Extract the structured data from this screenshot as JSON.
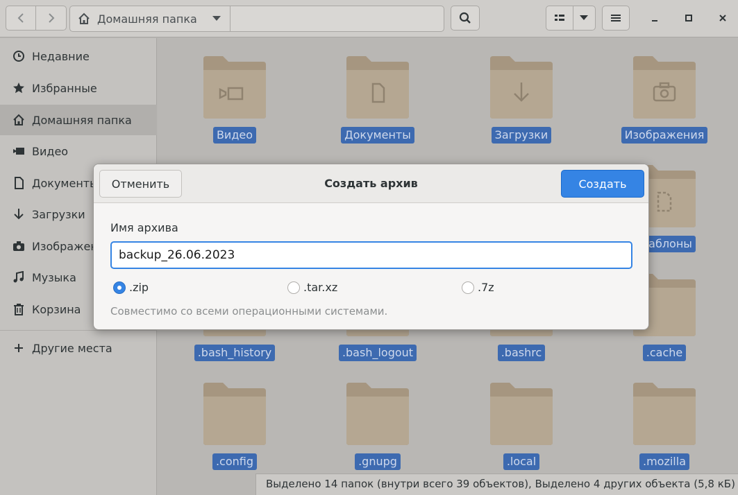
{
  "header": {
    "back_icon": "chevron-left-icon",
    "forward_icon": "chevron-right-icon",
    "path_home_label": "Домашняя папка",
    "search_icon": "search-icon",
    "view_icon": "list-view-icon",
    "menu_icon": "hamburger-menu-icon"
  },
  "sidebar": {
    "items": [
      {
        "label": "Недавние",
        "icon": "clock-icon"
      },
      {
        "label": "Избранные",
        "icon": "star-icon"
      },
      {
        "label": "Домашняя папка",
        "icon": "home-icon"
      },
      {
        "label": "Видео",
        "icon": "video-icon"
      },
      {
        "label": "Документы",
        "icon": "document-icon"
      },
      {
        "label": "Загрузки",
        "icon": "download-icon"
      },
      {
        "label": "Изображения",
        "icon": "camera-icon"
      },
      {
        "label": "Музыка",
        "icon": "music-icon"
      },
      {
        "label": "Корзина",
        "icon": "trash-icon"
      },
      {
        "label": "Другие места",
        "icon": "plus-icon"
      }
    ]
  },
  "files": [
    {
      "label": "Видео",
      "icon": "video-icon"
    },
    {
      "label": "Документы",
      "icon": "document-icon"
    },
    {
      "label": "Загрузки",
      "icon": "download-icon"
    },
    {
      "label": "Изображения",
      "icon": "camera-icon"
    },
    {
      "label": "",
      "icon": ""
    },
    {
      "label": "",
      "icon": ""
    },
    {
      "label": "",
      "icon": ""
    },
    {
      "label": "Шаблоны",
      "icon": "template-icon"
    },
    {
      "label": ".bash_history",
      "icon": ""
    },
    {
      "label": ".bash_logout",
      "icon": ""
    },
    {
      "label": ".bashrc",
      "icon": ""
    },
    {
      "label": ".cache",
      "icon": ""
    },
    {
      "label": ".config",
      "icon": ""
    },
    {
      "label": ".gnupg",
      "icon": ""
    },
    {
      "label": ".local",
      "icon": ""
    },
    {
      "label": ".mozilla",
      "icon": ""
    }
  ],
  "status": {
    "text": "Выделено 14 папок (внутри всего 39 объектов), Выделено 4 других объекта (5,8 кБ)"
  },
  "dialog": {
    "title": "Создать архив",
    "cancel_label": "Отменить",
    "create_label": "Создать",
    "name_label": "Имя архива",
    "name_value": "backup_26.06.2023",
    "formats": [
      {
        "label": ".zip",
        "checked": true
      },
      {
        "label": ".tar.xz",
        "checked": false
      },
      {
        "label": ".7z",
        "checked": false
      }
    ],
    "hint": "Совместимо со всеми операционными системами."
  },
  "colors": {
    "accent": "#3584e4",
    "selection": "#3d6ab0",
    "folder": "#a69680"
  }
}
